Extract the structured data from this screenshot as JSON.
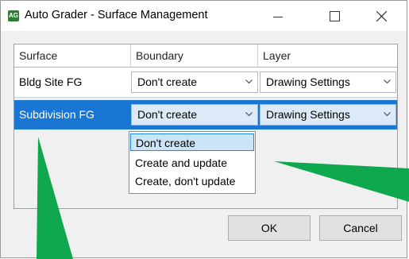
{
  "window": {
    "app_icon_text": "AG",
    "title": "Auto Grader - Surface Management"
  },
  "grid": {
    "columns": [
      "Surface",
      "Boundary",
      "Layer"
    ],
    "rows": [
      {
        "surface": "Bldg Site FG",
        "boundary": "Don't create",
        "layer": "Drawing Settings",
        "selected": false
      },
      {
        "surface": "Subdivision FG",
        "boundary": "Don't create",
        "layer": "Drawing Settings",
        "selected": true
      }
    ]
  },
  "boundary_dropdown": {
    "options": [
      "Don't create",
      "Create and update",
      "Create, don't update"
    ],
    "highlighted_option": "Don't create"
  },
  "buttons": {
    "ok": "OK",
    "cancel": "Cancel"
  },
  "colors": {
    "selected_row": "#1976d2",
    "annotation_arrow": "#10a84e"
  }
}
